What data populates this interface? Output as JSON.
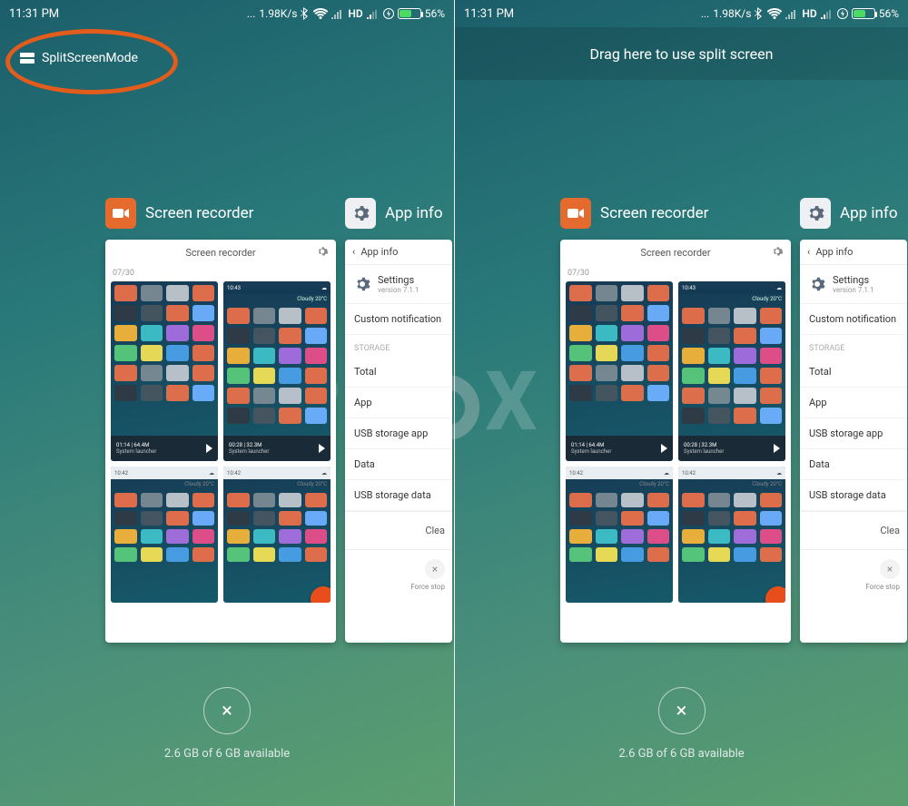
{
  "status": {
    "time": "11:31 PM",
    "speed": "1.98K/s",
    "hd": "HD",
    "battery_pct": "56%"
  },
  "left": {
    "split_label": "SplitScreenMode"
  },
  "right": {
    "drag_label": "Drag here to use split screen"
  },
  "cards": {
    "recorder": {
      "title": "Screen recorder",
      "card_title": "Screen recorder",
      "date": "07/30",
      "clip1": {
        "time": "01:14",
        "size": "64.4M",
        "app": "System launcher"
      },
      "clip2": {
        "time": "00:28",
        "size": "32.3M",
        "app": "System launcher"
      },
      "thumb_time_big": "10:43",
      "thumb_time_small": "10:42",
      "thumb_weather": "Cloudy  20°C"
    },
    "appinfo": {
      "title": "App info",
      "back_label": "App info",
      "settings_name": "Settings",
      "settings_ver": "version 7.1.1",
      "custom_notif": "Custom notification",
      "section_storage": "STORAGE",
      "total": "Total",
      "app": "App",
      "usb_app": "USB storage app",
      "data": "Data",
      "usb_data": "USB storage data",
      "clear": "Clea",
      "force_stop": "Force stop"
    }
  },
  "footer": {
    "mem": "2.6 GB of 6 GB available"
  },
  "colors": {
    "accent": "#e46a2e",
    "anno": "#e25c1b",
    "battery_fill": "#4cd964"
  },
  "app_grid_colors": [
    "#e8704a",
    "#7a8a94",
    "#c0c6ce",
    "#e8704a",
    "#2f3a44",
    "#475560",
    "#e8704a",
    "#6db0ff",
    "#f2b43a",
    "#3ec1c9",
    "#a56fe0",
    "#e84e8a",
    "#59c97a",
    "#f0e055",
    "#4aa0e8",
    "#e86f4a"
  ]
}
